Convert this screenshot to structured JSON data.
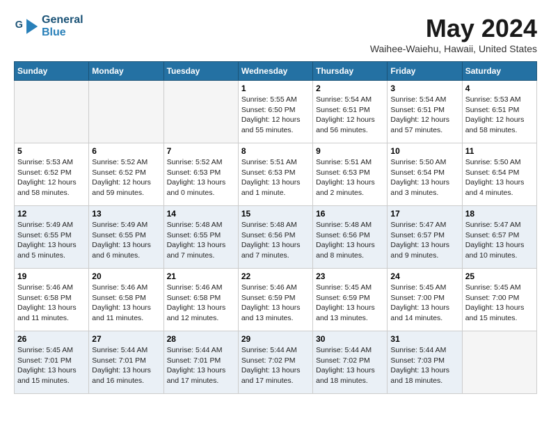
{
  "header": {
    "logo_line1": "General",
    "logo_line2": "Blue",
    "month_year": "May 2024",
    "location": "Waihee-Waiehu, Hawaii, United States"
  },
  "days_of_week": [
    "Sunday",
    "Monday",
    "Tuesday",
    "Wednesday",
    "Thursday",
    "Friday",
    "Saturday"
  ],
  "weeks": [
    [
      {
        "day": "",
        "empty": true
      },
      {
        "day": "",
        "empty": true
      },
      {
        "day": "",
        "empty": true
      },
      {
        "day": "1",
        "info": "Sunrise: 5:55 AM\nSunset: 6:50 PM\nDaylight: 12 hours\nand 55 minutes."
      },
      {
        "day": "2",
        "info": "Sunrise: 5:54 AM\nSunset: 6:51 PM\nDaylight: 12 hours\nand 56 minutes."
      },
      {
        "day": "3",
        "info": "Sunrise: 5:54 AM\nSunset: 6:51 PM\nDaylight: 12 hours\nand 57 minutes."
      },
      {
        "day": "4",
        "info": "Sunrise: 5:53 AM\nSunset: 6:51 PM\nDaylight: 12 hours\nand 58 minutes."
      }
    ],
    [
      {
        "day": "5",
        "info": "Sunrise: 5:53 AM\nSunset: 6:52 PM\nDaylight: 12 hours\nand 58 minutes."
      },
      {
        "day": "6",
        "info": "Sunrise: 5:52 AM\nSunset: 6:52 PM\nDaylight: 12 hours\nand 59 minutes."
      },
      {
        "day": "7",
        "info": "Sunrise: 5:52 AM\nSunset: 6:53 PM\nDaylight: 13 hours\nand 0 minutes."
      },
      {
        "day": "8",
        "info": "Sunrise: 5:51 AM\nSunset: 6:53 PM\nDaylight: 13 hours\nand 1 minute."
      },
      {
        "day": "9",
        "info": "Sunrise: 5:51 AM\nSunset: 6:53 PM\nDaylight: 13 hours\nand 2 minutes."
      },
      {
        "day": "10",
        "info": "Sunrise: 5:50 AM\nSunset: 6:54 PM\nDaylight: 13 hours\nand 3 minutes."
      },
      {
        "day": "11",
        "info": "Sunrise: 5:50 AM\nSunset: 6:54 PM\nDaylight: 13 hours\nand 4 minutes."
      }
    ],
    [
      {
        "day": "12",
        "info": "Sunrise: 5:49 AM\nSunset: 6:55 PM\nDaylight: 13 hours\nand 5 minutes."
      },
      {
        "day": "13",
        "info": "Sunrise: 5:49 AM\nSunset: 6:55 PM\nDaylight: 13 hours\nand 6 minutes."
      },
      {
        "day": "14",
        "info": "Sunrise: 5:48 AM\nSunset: 6:55 PM\nDaylight: 13 hours\nand 7 minutes."
      },
      {
        "day": "15",
        "info": "Sunrise: 5:48 AM\nSunset: 6:56 PM\nDaylight: 13 hours\nand 7 minutes."
      },
      {
        "day": "16",
        "info": "Sunrise: 5:48 AM\nSunset: 6:56 PM\nDaylight: 13 hours\nand 8 minutes."
      },
      {
        "day": "17",
        "info": "Sunrise: 5:47 AM\nSunset: 6:57 PM\nDaylight: 13 hours\nand 9 minutes."
      },
      {
        "day": "18",
        "info": "Sunrise: 5:47 AM\nSunset: 6:57 PM\nDaylight: 13 hours\nand 10 minutes."
      }
    ],
    [
      {
        "day": "19",
        "info": "Sunrise: 5:46 AM\nSunset: 6:58 PM\nDaylight: 13 hours\nand 11 minutes."
      },
      {
        "day": "20",
        "info": "Sunrise: 5:46 AM\nSunset: 6:58 PM\nDaylight: 13 hours\nand 11 minutes."
      },
      {
        "day": "21",
        "info": "Sunrise: 5:46 AM\nSunset: 6:58 PM\nDaylight: 13 hours\nand 12 minutes."
      },
      {
        "day": "22",
        "info": "Sunrise: 5:46 AM\nSunset: 6:59 PM\nDaylight: 13 hours\nand 13 minutes."
      },
      {
        "day": "23",
        "info": "Sunrise: 5:45 AM\nSunset: 6:59 PM\nDaylight: 13 hours\nand 13 minutes."
      },
      {
        "day": "24",
        "info": "Sunrise: 5:45 AM\nSunset: 7:00 PM\nDaylight: 13 hours\nand 14 minutes."
      },
      {
        "day": "25",
        "info": "Sunrise: 5:45 AM\nSunset: 7:00 PM\nDaylight: 13 hours\nand 15 minutes."
      }
    ],
    [
      {
        "day": "26",
        "info": "Sunrise: 5:45 AM\nSunset: 7:01 PM\nDaylight: 13 hours\nand 15 minutes."
      },
      {
        "day": "27",
        "info": "Sunrise: 5:44 AM\nSunset: 7:01 PM\nDaylight: 13 hours\nand 16 minutes."
      },
      {
        "day": "28",
        "info": "Sunrise: 5:44 AM\nSunset: 7:01 PM\nDaylight: 13 hours\nand 17 minutes."
      },
      {
        "day": "29",
        "info": "Sunrise: 5:44 AM\nSunset: 7:02 PM\nDaylight: 13 hours\nand 17 minutes."
      },
      {
        "day": "30",
        "info": "Sunrise: 5:44 AM\nSunset: 7:02 PM\nDaylight: 13 hours\nand 18 minutes."
      },
      {
        "day": "31",
        "info": "Sunrise: 5:44 AM\nSunset: 7:03 PM\nDaylight: 13 hours\nand 18 minutes."
      },
      {
        "day": "",
        "empty": true
      }
    ]
  ]
}
